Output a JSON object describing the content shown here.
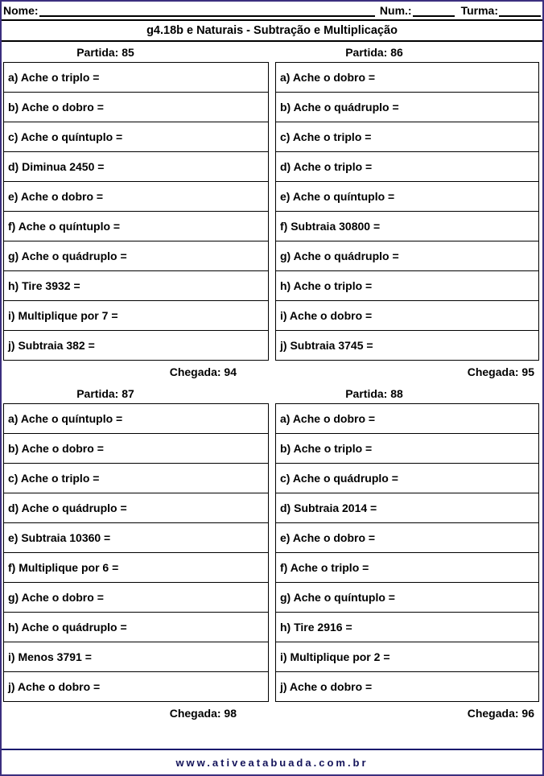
{
  "header": {
    "name_label": "Nome:",
    "num_label": "Num.:",
    "turma_label": "Turma:",
    "name_value": "",
    "num_value": "",
    "turma_value": ""
  },
  "title": "g4.18b e Naturais - Subtração e Multiplicação",
  "labels": {
    "partida": "Partida:",
    "chegada": "Chegada:"
  },
  "footer": {
    "url": "www.ativeatabuada.com.br"
  },
  "colors": {
    "page_border": "#3b2f7f",
    "table_border": "#000000",
    "text": "#000000",
    "footer_text": "#14145a",
    "footer_rule": "#1a1a6e"
  },
  "blocks": [
    {
      "partida_label": "Partida:",
      "partida_value": "85",
      "chegada_label": "Chegada:",
      "chegada_value": "94",
      "items": [
        "a) Ache o triplo  =",
        "b) Ache o dobro  =",
        "c) Ache o quíntuplo  =",
        "d) Diminua 2450 =",
        "e) Ache o dobro  =",
        "f) Ache o quíntuplo  =",
        "g) Ache o quádruplo  =",
        "h) Tire 3932 =",
        "i) Multiplique por 7 =",
        "j) Subtraia 382 ="
      ]
    },
    {
      "partida_label": "Partida:",
      "partida_value": "86",
      "chegada_label": "Chegada:",
      "chegada_value": "95",
      "items": [
        "a) Ache o dobro  =",
        "b) Ache o quádruplo  =",
        "c) Ache o triplo  =",
        "d) Ache o triplo  =",
        "e) Ache o quíntuplo  =",
        "f) Subtraia 30800 =",
        "g) Ache o quádruplo  =",
        "h) Ache o triplo  =",
        "i) Ache o dobro  =",
        "j) Subtraia 3745 ="
      ]
    },
    {
      "partida_label": "Partida:",
      "partida_value": "87",
      "chegada_label": "Chegada:",
      "chegada_value": "98",
      "items": [
        "a) Ache o quíntuplo  =",
        "b) Ache o dobro  =",
        "c) Ache o triplo  =",
        "d) Ache o quádruplo  =",
        "e) Subtraia 10360 =",
        "f) Multiplique por 6 =",
        "g) Ache o dobro  =",
        "h) Ache o quádruplo  =",
        "i) Menos 3791 =",
        "j) Ache o dobro  ="
      ]
    },
    {
      "partida_label": "Partida:",
      "partida_value": "88",
      "chegada_label": "Chegada:",
      "chegada_value": "96",
      "items": [
        "a) Ache o dobro  =",
        "b) Ache o triplo  =",
        "c) Ache o quádruplo  =",
        "d) Subtraia 2014 =",
        "e) Ache o dobro  =",
        "f) Ache o triplo  =",
        "g) Ache o quíntuplo  =",
        "h) Tire 2916 =",
        "i) Multiplique por 2 =",
        "j) Ache o dobro  ="
      ]
    }
  ]
}
